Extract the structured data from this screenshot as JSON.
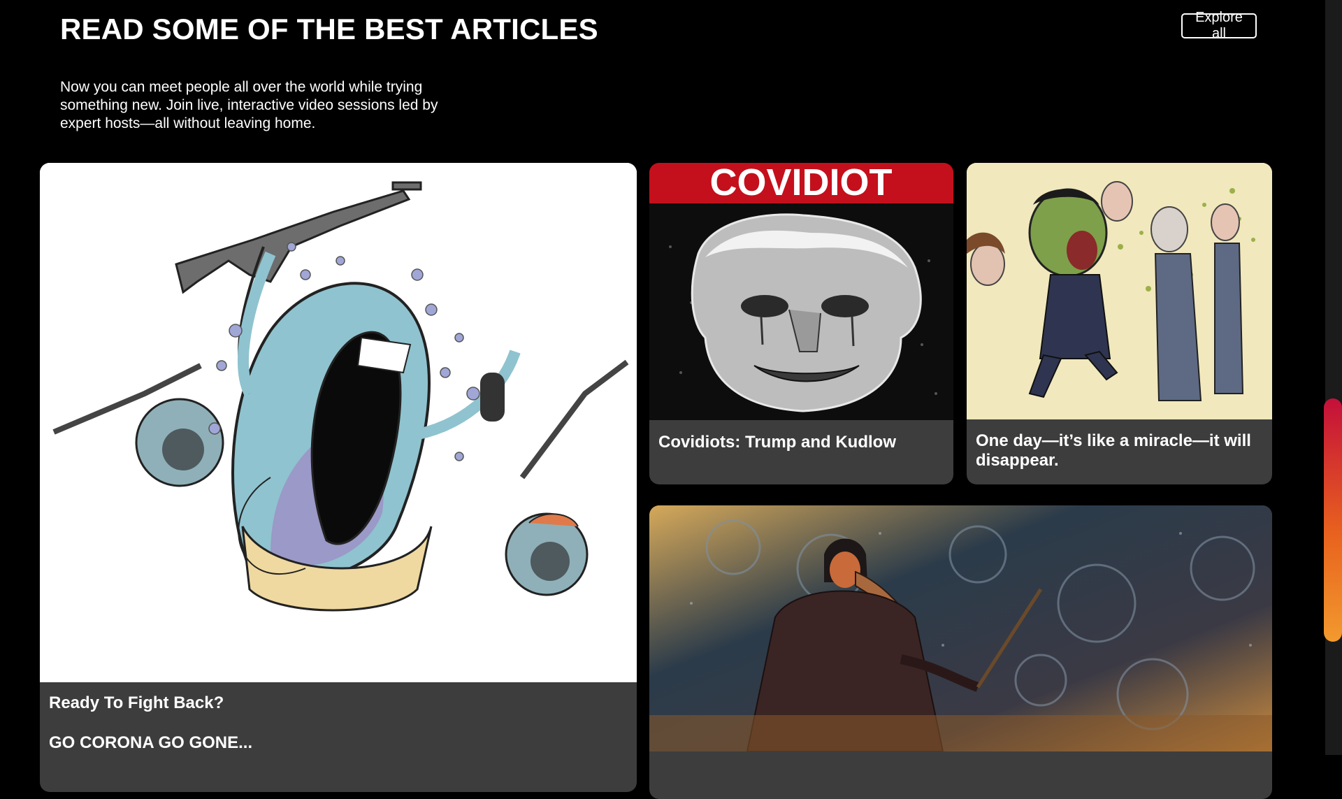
{
  "section": {
    "heading": "READ SOME OF THE BEST ARTICLES",
    "explore_label": "Explore all",
    "intro": "Now you can meet people all over the world while trying something new. Join live, interactive video sessions led by expert hosts—all without leaving home."
  },
  "articles": [
    {
      "title": "Ready To Fight Back?",
      "subtitle": "GO CORONA GO GONE..."
    },
    {
      "title": "Covidiots: Trump and Kudlow",
      "image_text": "COVIDIOT"
    },
    {
      "title": "One day—it’s like a miracle—it will disappear."
    },
    {
      "title": ""
    }
  ],
  "colors": {
    "background": "#000000",
    "card": "#3d3d3d",
    "covidiot_banner": "#c4101c",
    "scroll_thumb_start": "#c40f3a",
    "scroll_thumb_end": "#f29a2e"
  }
}
